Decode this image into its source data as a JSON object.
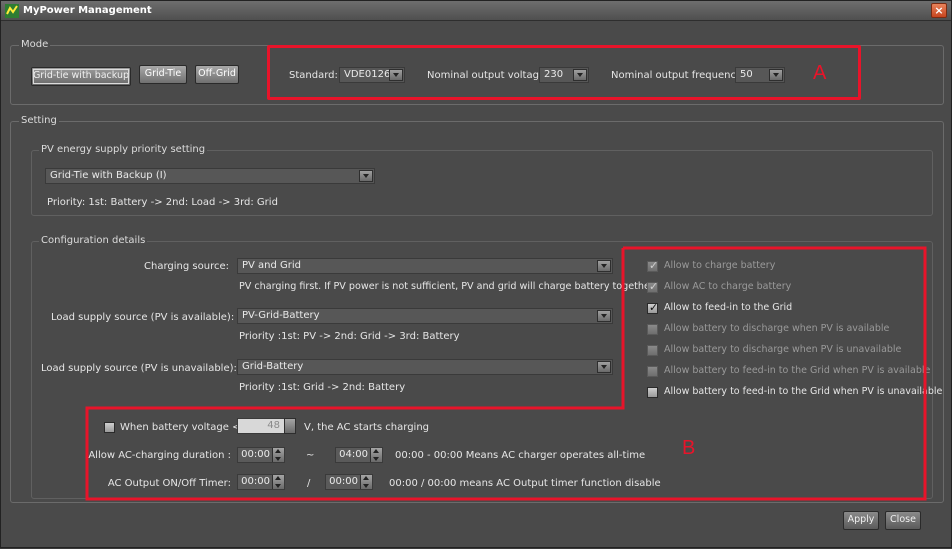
{
  "window": {
    "title": "MyPower Management",
    "close_glyph": "×"
  },
  "mode": {
    "group_label": "Mode",
    "buttons": [
      {
        "label": "Grid-tie with backup",
        "active": true
      },
      {
        "label": "Grid-Tie",
        "active": false
      },
      {
        "label": "Off-Grid",
        "active": false
      }
    ],
    "standard_label": "Standard:",
    "standard_value": "VDE0126",
    "nominal_voltage_label": "Nominal output voltage:",
    "nominal_voltage_value": "230",
    "nominal_freq_label": "Nominal output frequency:",
    "nominal_freq_value": "50"
  },
  "setting": {
    "group_label": "Setting",
    "pv_priority": {
      "group_label": "PV energy supply priority setting",
      "selected": "Grid-Tie with Backup (I)",
      "priority_text": "Priority: 1st: Battery -> 2nd: Load -> 3rd: Grid"
    },
    "config": {
      "group_label": "Configuration details",
      "charging_source_label": "Charging source:",
      "charging_source_value": "PV and Grid",
      "charging_source_note": "PV charging first. If PV power is not sufficient, PV and grid will charge battery together",
      "load_pv_avail_label": "Load supply source (PV is available):",
      "load_pv_avail_value": "PV-Grid-Battery",
      "load_pv_avail_note": "Priority :1st: PV -> 2nd: Grid -> 3rd: Battery",
      "load_pv_unavail_label": "Load supply source (PV is unavailable):",
      "load_pv_unavail_value": "Grid-Battery",
      "load_pv_unavail_note": "Priority :1st: Grid -> 2nd: Battery",
      "checkboxes": [
        {
          "label": "Allow to charge battery",
          "checked": true,
          "enabled": false
        },
        {
          "label": "Allow AC to charge battery",
          "checked": true,
          "enabled": false
        },
        {
          "label": "Allow to feed-in to the Grid",
          "checked": true,
          "enabled": true
        },
        {
          "label": "Allow battery to discharge when PV is available",
          "checked": false,
          "enabled": false
        },
        {
          "label": "Allow battery to discharge when PV is unavailable",
          "checked": false,
          "enabled": false
        },
        {
          "label": "Allow battery to feed-in to the Grid when PV is available",
          "checked": false,
          "enabled": false
        },
        {
          "label": "Allow battery to feed-in to the Grid when PV is unavailable",
          "checked": false,
          "enabled": true
        }
      ],
      "battery_voltage_label": "When battery voltage <",
      "battery_voltage_value": "48",
      "battery_voltage_unit": "V,  the AC starts charging",
      "ac_duration_label": "Allow AC-charging duration :",
      "ac_duration_from": "00:00",
      "ac_duration_sep": "~",
      "ac_duration_to": "04:00",
      "ac_duration_note": "00:00 - 00:00 Means AC charger operates all-time",
      "ac_timer_label": "AC Output ON/Off Timer:",
      "ac_timer_from": "00:00",
      "ac_timer_sep": "/",
      "ac_timer_to": "00:00",
      "ac_timer_note": "00:00 / 00:00 means AC Output timer function disable"
    }
  },
  "footer": {
    "apply_label": "Apply",
    "close_label": "Close"
  },
  "annotations": {
    "marker_a": "A",
    "marker_b": "B",
    "color": "#e8142a"
  }
}
